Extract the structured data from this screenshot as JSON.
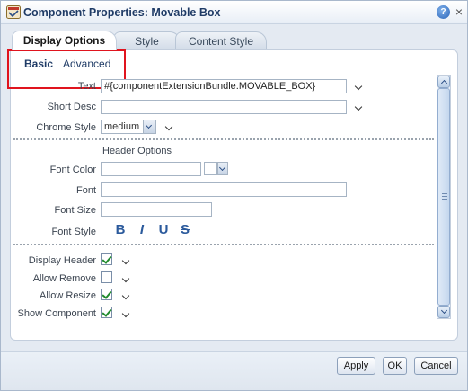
{
  "title": "Component Properties: Movable Box",
  "tabs": [
    {
      "label": "Display Options",
      "active": true
    },
    {
      "label": "Style",
      "active": false
    },
    {
      "label": "Content Style",
      "active": false
    }
  ],
  "subtabs": {
    "basic": "Basic",
    "advanced": "Advanced"
  },
  "fields": {
    "text": {
      "label": "Text",
      "value": "#{componentExtensionBundle.MOVABLE_BOX}"
    },
    "short_desc": {
      "label": "Short Desc",
      "value": ""
    },
    "chrome_style": {
      "label": "Chrome Style",
      "value": "medium"
    }
  },
  "header_options": {
    "title": "Header Options",
    "font_color": {
      "label": "Font Color",
      "value": ""
    },
    "font": {
      "label": "Font",
      "value": ""
    },
    "font_size": {
      "label": "Font Size",
      "value": ""
    },
    "font_style": {
      "label": "Font Style",
      "buttons": [
        "B",
        "I",
        "U",
        "S"
      ]
    }
  },
  "checkboxes": [
    {
      "label": "Display Header",
      "checked": true
    },
    {
      "label": "Allow Remove",
      "checked": false
    },
    {
      "label": "Allow Resize",
      "checked": true
    },
    {
      "label": "Show Component",
      "checked": true
    }
  ],
  "buttons": {
    "apply": "Apply",
    "ok": "OK",
    "cancel": "Cancel"
  },
  "help_glyph": "?",
  "close_glyph": "×",
  "colors": {
    "accent": "#1f3b66",
    "highlight": "#e0141e",
    "check": "#1f8a2c"
  }
}
